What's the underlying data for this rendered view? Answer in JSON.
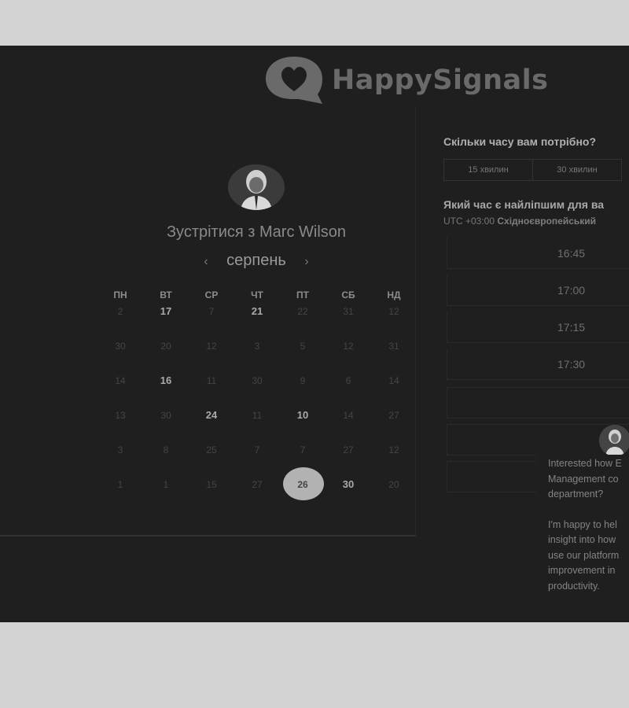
{
  "brand": {
    "name": "HappySignals",
    "logo_icon": "heart-chat-bubble-icon"
  },
  "scheduler": {
    "meeting_title": "Зустрітися з Marc Wilson",
    "month": "серпень",
    "prev_arrow": "‹",
    "next_arrow": "›",
    "weekdays": [
      "ПН",
      "ВТ",
      "СР",
      "ЧТ",
      "ПТ",
      "СБ",
      "НД"
    ],
    "weeks": [
      [
        "2",
        "17",
        "7",
        "21",
        "22",
        "31",
        "12"
      ],
      [
        "30",
        "20",
        "12",
        "3",
        "5",
        "12",
        "31"
      ],
      [
        "14",
        "16",
        "11",
        "30",
        "9",
        "6",
        "14"
      ],
      [
        "13",
        "30",
        "24",
        "11",
        "10",
        "14",
        "27"
      ],
      [
        "3",
        "8",
        "25",
        "7",
        "7",
        "27",
        "12"
      ],
      [
        "1",
        "1",
        "15",
        "27",
        "26",
        "30",
        "20"
      ]
    ],
    "selected_day": "26"
  },
  "duration": {
    "question": "Скільки часу вам потрібно?",
    "options": [
      "15 хвилин",
      "30 хвилин"
    ]
  },
  "time_pick": {
    "question": "Який час є найліпшим для ва",
    "timezone_prefix": "UTC +03:00 ",
    "timezone_name": "Східноєвропейський",
    "slots": [
      "16:45",
      "17:00",
      "17:15",
      "17:30",
      "",
      "",
      ""
    ]
  },
  "chat": {
    "message_1": [
      "Interested how E",
      "Management co",
      "department?"
    ],
    "message_2": [
      "I'm happy to hel",
      "insight into how",
      "use our platform",
      "improvement in",
      "productivity."
    ]
  }
}
